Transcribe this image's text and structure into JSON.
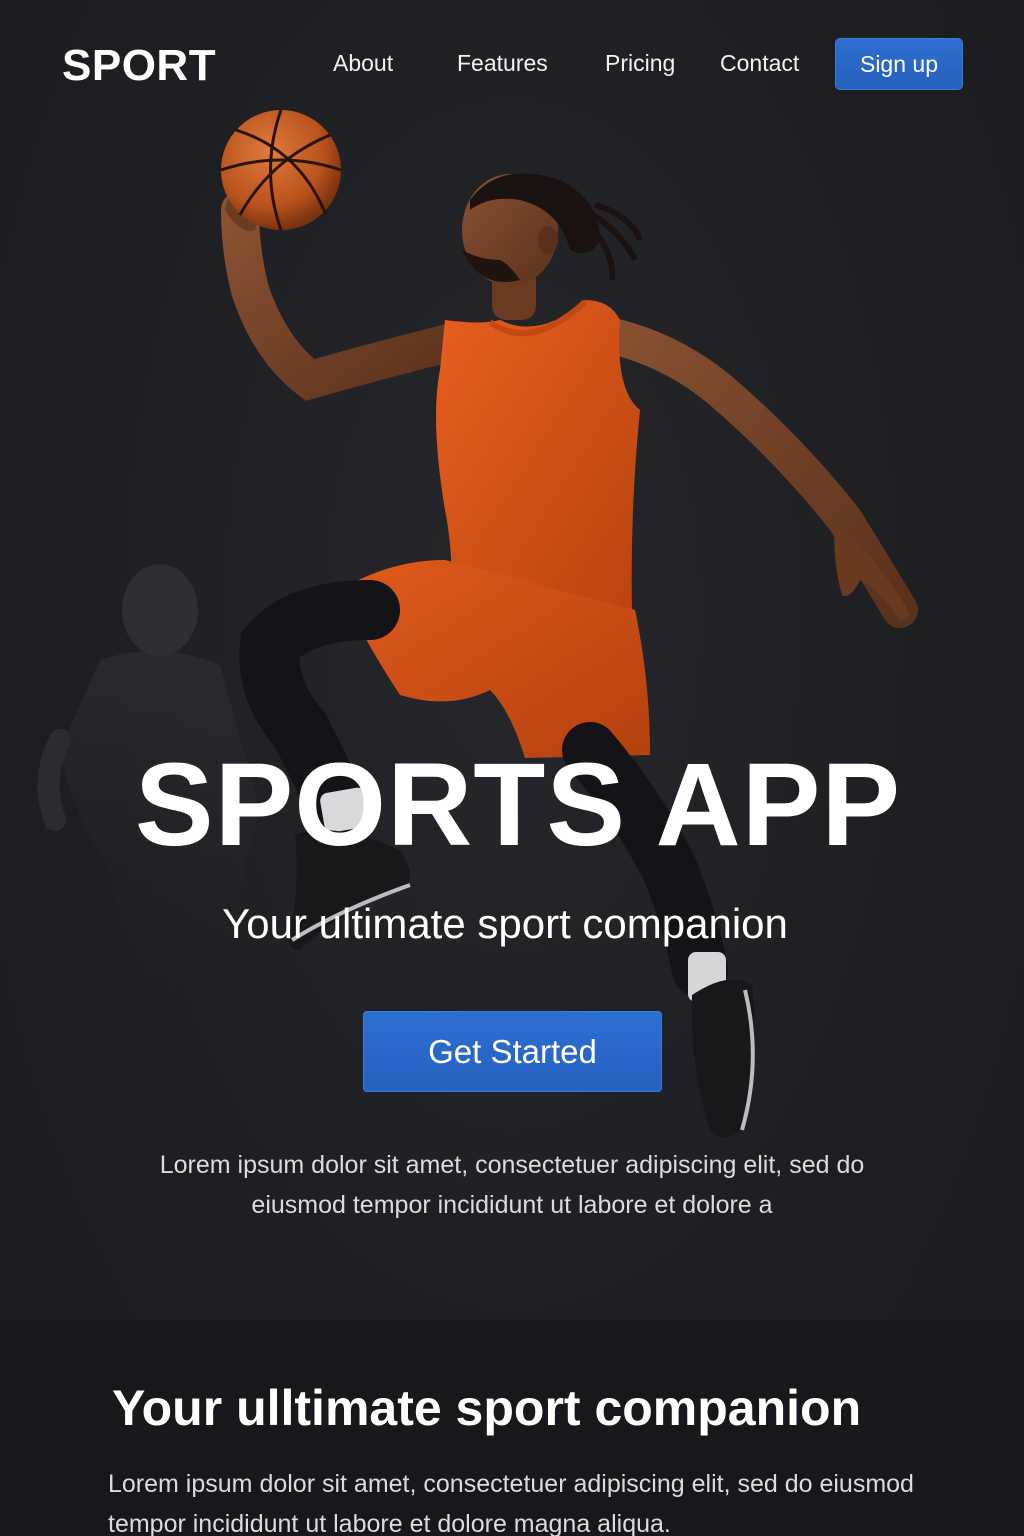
{
  "brand": {
    "logo": "SPORT"
  },
  "nav": {
    "links": [
      {
        "label": "About"
      },
      {
        "label": "Features"
      },
      {
        "label": "Pricing"
      },
      {
        "label": "Contact"
      }
    ],
    "signup_label": "Sign up"
  },
  "hero": {
    "title": "SPORTS APP",
    "subtitle": "Your ultimate sport companion",
    "cta_label": "Get Started",
    "description": "Lorem ipsum dolor sit amet, consectetuer adipiscing elit, sed do eiusmod tempor incididunt ut labore et dolore a",
    "photo": "basketball-player-leaping"
  },
  "section2": {
    "title": "Your ulltimate sport companion",
    "text": "Lorem ipsum dolor sit amet, consectetuer adipiscing elit, sed do eiusmod tempor incididunt ut labore et dolore magna aliqua."
  },
  "colors": {
    "background": "#1e1f23",
    "accent": "#2a66c6",
    "jersey": "#d9521a",
    "section_bg": "#17181c"
  }
}
